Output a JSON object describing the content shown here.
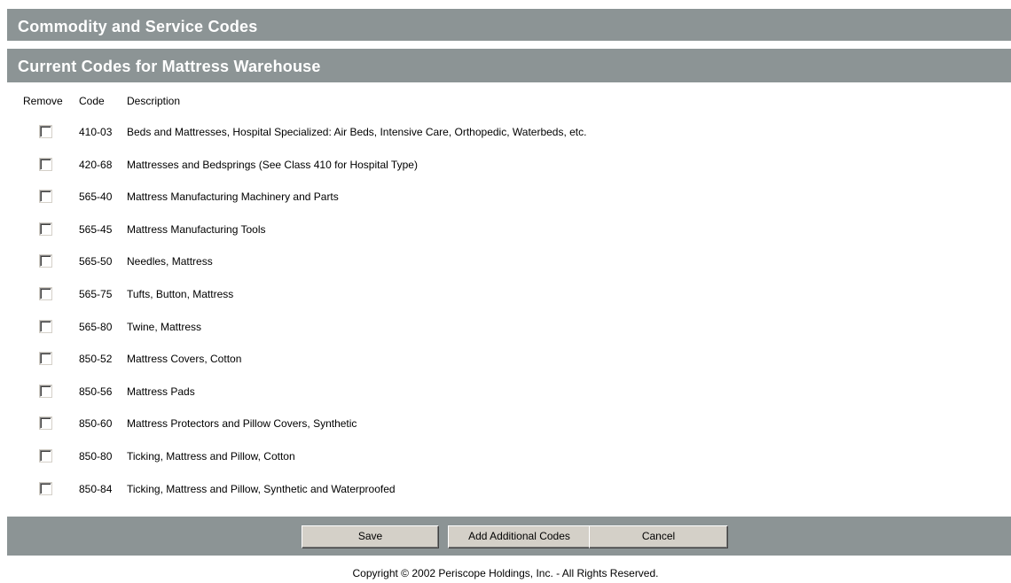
{
  "header": {
    "title": "Commodity and Service Codes",
    "subtitle": "Current Codes for Mattress Warehouse"
  },
  "table": {
    "columns": {
      "remove": "Remove",
      "code": "Code",
      "description": "Description"
    },
    "rows": [
      {
        "code": "410-03",
        "description": "Beds and Mattresses, Hospital Specialized: Air Beds, Intensive Care, Orthopedic, Waterbeds, etc.",
        "checked": false
      },
      {
        "code": "420-68",
        "description": "Mattresses and Bedsprings (See Class 410 for Hospital Type)",
        "checked": false
      },
      {
        "code": "565-40",
        "description": "Mattress Manufacturing Machinery and Parts",
        "checked": false
      },
      {
        "code": "565-45",
        "description": "Mattress Manufacturing Tools",
        "checked": false
      },
      {
        "code": "565-50",
        "description": "Needles, Mattress",
        "checked": false
      },
      {
        "code": "565-75",
        "description": "Tufts, Button, Mattress",
        "checked": false
      },
      {
        "code": "565-80",
        "description": "Twine, Mattress",
        "checked": false
      },
      {
        "code": "850-52",
        "description": "Mattress Covers, Cotton",
        "checked": false
      },
      {
        "code": "850-56",
        "description": "Mattress Pads",
        "checked": false
      },
      {
        "code": "850-60",
        "description": "Mattress Protectors and Pillow Covers, Synthetic",
        "checked": false
      },
      {
        "code": "850-80",
        "description": "Ticking, Mattress and Pillow, Cotton",
        "checked": false
      },
      {
        "code": "850-84",
        "description": "Ticking, Mattress and Pillow, Synthetic and Waterproofed",
        "checked": false
      }
    ]
  },
  "actions": {
    "save_label": "Save",
    "add_label": "Add Additional Codes",
    "cancel_label": "Cancel"
  },
  "footer": {
    "copyright": "Copyright © 2002 Periscope Holdings, Inc. - All Rights Reserved."
  },
  "colors": {
    "bar_background": "#8c9495",
    "bar_text": "#ffffff",
    "button_face": "#d4d0c8"
  }
}
